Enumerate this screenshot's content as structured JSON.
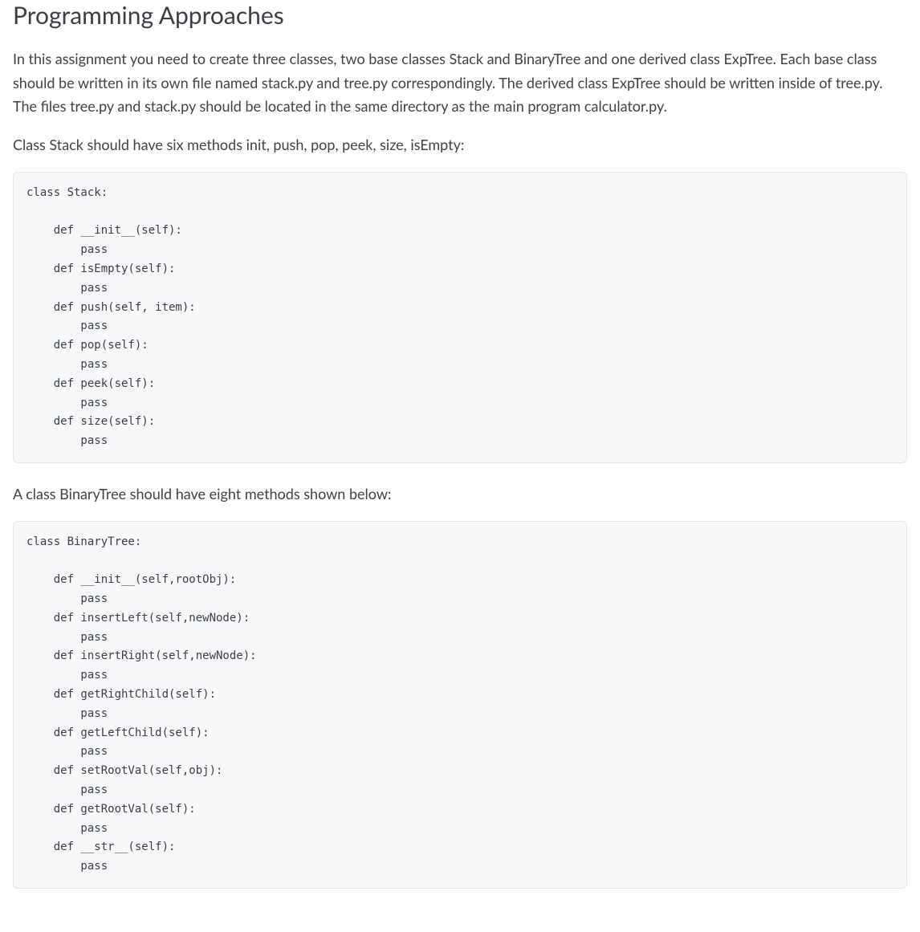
{
  "title": "Programming Approaches",
  "intro": "In this assignment you need to create three classes, two base classes Stack and BinaryTree and one derived class ExpTree. Each base class should be written in its own file named stack.py and tree.py correspondingly. The derived class ExpTree should be written inside of tree.py. The files tree.py and stack.py should be located in the same directory as the main program calculator.py.",
  "stack_intro": "Class Stack should have six methods init, push, pop, peek, size, isEmpty:",
  "stack_code": "class Stack:\n\n    def __init__(self):\n        pass\n    def isEmpty(self):\n        pass\n    def push(self, item):\n        pass\n    def pop(self):\n        pass\n    def peek(self):\n        pass\n    def size(self):\n        pass",
  "tree_intro": "A class BinaryTree should have eight methods shown below:",
  "tree_code": "class BinaryTree:\n\n    def __init__(self,rootObj):\n        pass\n    def insertLeft(self,newNode):\n        pass\n    def insertRight(self,newNode):\n        pass\n    def getRightChild(self):\n        pass\n    def getLeftChild(self):\n        pass\n    def setRootVal(self,obj):\n        pass\n    def getRootVal(self):\n        pass\n    def __str__(self):\n        pass"
}
